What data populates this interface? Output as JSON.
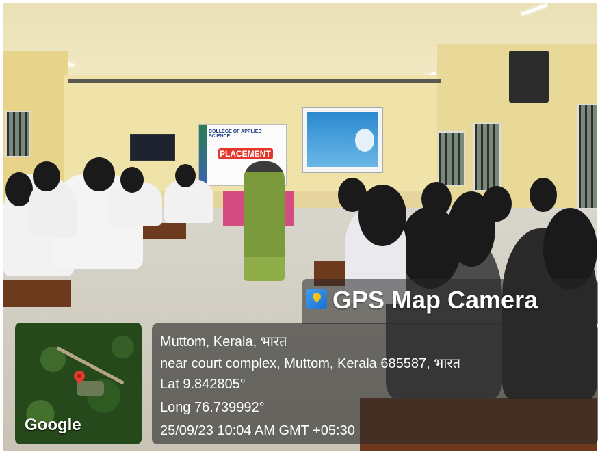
{
  "overlay": {
    "app_name": "GPS Map Camera",
    "location_title": "Muttom, Kerala, भारत",
    "address": "near court complex, Muttom, Kerala 685587, भारत",
    "latitude": "Lat 9.842805°",
    "longitude": "Long 76.739992°",
    "timestamp": "25/09/23 10:04 AM GMT +05:30"
  },
  "map": {
    "provider": "Google",
    "marker_color": "#e43b2f"
  },
  "scene": {
    "banner_text": "PLACEMENT",
    "banner_heading": "COLLEGE OF APPLIED SCIENCE"
  }
}
